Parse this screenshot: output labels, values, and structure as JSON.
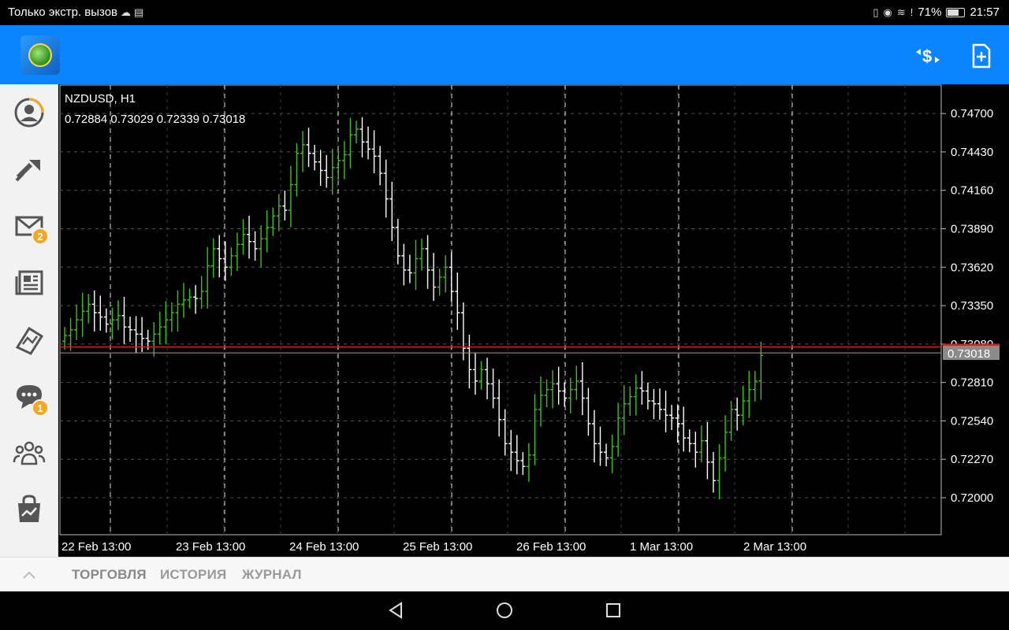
{
  "status_bar": {
    "carrier_text": "Только экстр. вызов",
    "battery_percent": "71%",
    "time": "21:57",
    "battery_level": 0.71,
    "icons": [
      "cloud-icon",
      "sim-icon",
      "vibrate-icon",
      "eye-icon",
      "wifi-icon",
      "alert-icon"
    ]
  },
  "app_bar": {
    "logo": "metatrader-logo",
    "actions": [
      "symbols-icon",
      "new-order-icon"
    ]
  },
  "sidebar": {
    "items": [
      {
        "name": "account-icon"
      },
      {
        "name": "trade-icon"
      },
      {
        "name": "mail-icon",
        "badge": "2"
      },
      {
        "name": "news-icon"
      },
      {
        "name": "tradays-icon"
      },
      {
        "name": "chat-icon",
        "badge": "1"
      },
      {
        "name": "community-icon"
      },
      {
        "name": "market-icon"
      }
    ]
  },
  "chart": {
    "symbol": "NZDUSD, H1",
    "ohlc": "0.72884 0.73029 0.72339 0.73018",
    "current_price": "0.73018",
    "bid_price_hidden_label": "0.73029",
    "colors": {
      "background": "#000000",
      "grid": "#555555",
      "bull": "#3fbf1f",
      "bear": "#ffffff",
      "ask_line": "#d62020",
      "bid_line": "#9a9a9a"
    }
  },
  "chart_data": {
    "type": "bar",
    "title": "NZDUSD, H1",
    "y_ticks": [
      "0.74700",
      "0.74430",
      "0.74160",
      "0.73890",
      "0.73620",
      "0.73350",
      "0.73080",
      "0.72810",
      "0.72540",
      "0.72270",
      "0.72000"
    ],
    "x_ticks": [
      "22 Feb 13:00",
      "23 Feb 13:00",
      "24 Feb 13:00",
      "25 Feb 13:00",
      "26 Feb 13:00",
      "1 Mar 13:00",
      "2 Mar 13:00"
    ],
    "ylim": [
      0.7174,
      0.749
    ],
    "current_price": 0.73018,
    "ask_price": 0.7306,
    "series_close": [
      0.7314,
      0.7318,
      0.7325,
      0.7331,
      0.7336,
      0.733,
      0.7327,
      0.7322,
      0.7325,
      0.7328,
      0.732,
      0.7318,
      0.7315,
      0.7312,
      0.731,
      0.7315,
      0.732,
      0.7325,
      0.733,
      0.7336,
      0.7339,
      0.7341,
      0.734,
      0.7345,
      0.7363,
      0.7375,
      0.7368,
      0.7362,
      0.737,
      0.7378,
      0.7385,
      0.738,
      0.7375,
      0.7382,
      0.739,
      0.7398,
      0.7405,
      0.7402,
      0.742,
      0.7442,
      0.7448,
      0.7442,
      0.7436,
      0.743,
      0.7425,
      0.7432,
      0.7437,
      0.7441,
      0.7455,
      0.7459,
      0.745,
      0.7445,
      0.744,
      0.7428,
      0.741,
      0.739,
      0.737,
      0.736,
      0.7358,
      0.7368,
      0.7375,
      0.736,
      0.7348,
      0.7355,
      0.7362,
      0.7345,
      0.733,
      0.7305,
      0.729,
      0.7282,
      0.729,
      0.728,
      0.727,
      0.7255,
      0.7238,
      0.7232,
      0.7226,
      0.7222,
      0.723,
      0.7262,
      0.7272,
      0.7276,
      0.728,
      0.7275,
      0.727,
      0.7276,
      0.7282,
      0.727,
      0.7252,
      0.7238,
      0.7232,
      0.7228,
      0.7236,
      0.7256,
      0.7266,
      0.7271,
      0.7277,
      0.7275,
      0.7268,
      0.7266,
      0.7262,
      0.7258,
      0.7256,
      0.7252,
      0.7242,
      0.7238,
      0.7232,
      0.724,
      0.7225,
      0.7212,
      0.7228,
      0.7246,
      0.7262,
      0.7258,
      0.7268,
      0.7276,
      0.7282,
      0.73
    ]
  },
  "bottom_tabs": {
    "items": [
      {
        "label": "ТОРГОВЛЯ",
        "active": true
      },
      {
        "label": "ИСТОРИЯ",
        "active": false
      },
      {
        "label": "ЖУРНАЛ",
        "active": false
      }
    ]
  },
  "nav_bar": {
    "buttons": [
      "back-icon",
      "home-icon",
      "recents-icon"
    ]
  }
}
